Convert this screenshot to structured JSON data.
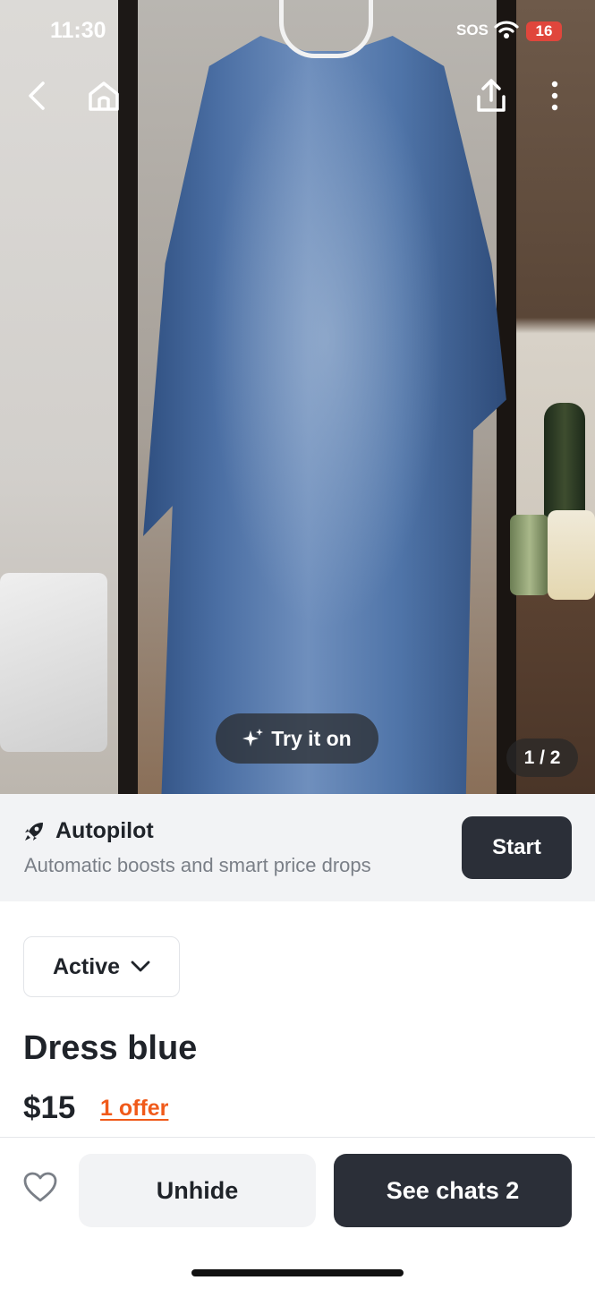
{
  "status_bar": {
    "time": "11:30",
    "sos": "SOS",
    "battery": "16",
    "battery_color": "#e0463c"
  },
  "nav": {
    "back_icon": "chevron-left-icon",
    "home_icon": "home-icon",
    "share_icon": "share-icon",
    "more_icon": "more-vertical-icon"
  },
  "photo": {
    "try_on_label": "Try it on",
    "try_on_icon": "sparkle-icon",
    "counter": "1 / 2"
  },
  "autopilot": {
    "icon": "rocket-icon",
    "title": "Autopilot",
    "subtitle": "Automatic boosts and smart price drops",
    "start_label": "Start"
  },
  "listing": {
    "status": "Active",
    "status_icon": "chevron-down-icon",
    "title": "Dress blue",
    "price": "$15",
    "offers": "1 offer",
    "offer_color": "#f05a1a"
  },
  "actions": {
    "favorite_icon": "heart-icon",
    "unhide_label": "Unhide",
    "see_chats_label": "See chats 2",
    "dark_button_color": "#2b2f38"
  }
}
